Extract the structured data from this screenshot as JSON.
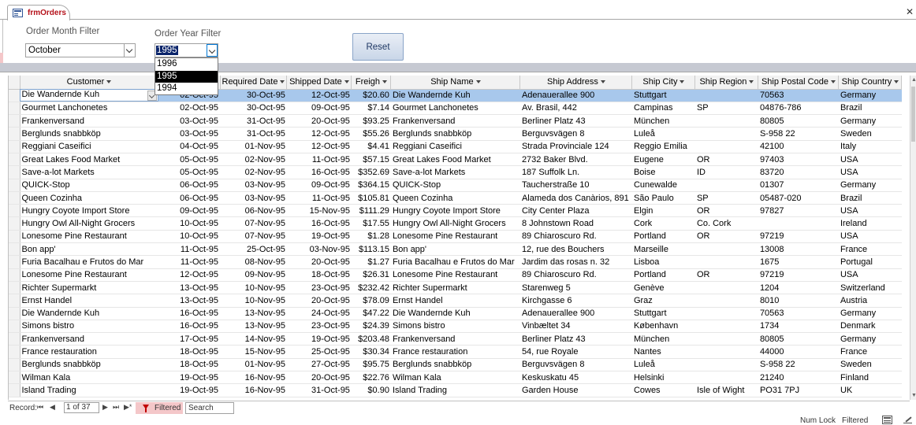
{
  "tab": {
    "title": "frmOrders",
    "close_glyph": "✕"
  },
  "filters": {
    "month_label": "Order Month Filter",
    "month_value": "October",
    "year_label": "Order Year Filter",
    "year_value": "1995",
    "year_options": [
      "1996",
      "1995",
      "1994"
    ],
    "year_selected_index": 1
  },
  "reset_label": "Reset",
  "table": {
    "columns": [
      "Customer",
      "Required Date",
      "Shipped Date",
      "Freigh",
      "Ship Name",
      "Ship Address",
      "Ship City",
      "Ship Region",
      "Ship Postal Code",
      "Ship Country"
    ],
    "current_row_index": 0,
    "rows": [
      [
        "Die Wandernde Kuh",
        "02-Oct-95",
        "30-Oct-95",
        "12-Oct-95",
        "$20.60",
        "Die Wandernde Kuh",
        "Adenauerallee 900",
        "Stuttgart",
        "",
        "70563",
        "Germany"
      ],
      [
        "Gourmet Lanchonetes",
        "02-Oct-95",
        "30-Oct-95",
        "09-Oct-95",
        "$7.14",
        "Gourmet Lanchonetes",
        "Av. Brasil, 442",
        "Campinas",
        "SP",
        "04876-786",
        "Brazil"
      ],
      [
        "Frankenversand",
        "03-Oct-95",
        "31-Oct-95",
        "20-Oct-95",
        "$93.25",
        "Frankenversand",
        "Berliner Platz 43",
        "München",
        "",
        "80805",
        "Germany"
      ],
      [
        "Berglunds snabbköp",
        "03-Oct-95",
        "31-Oct-95",
        "12-Oct-95",
        "$55.26",
        "Berglunds snabbköp",
        "Berguvsvägen  8",
        "Luleå",
        "",
        "S-958 22",
        "Sweden"
      ],
      [
        "Reggiani Caseifici",
        "04-Oct-95",
        "01-Nov-95",
        "12-Oct-95",
        "$4.41",
        "Reggiani Caseifici",
        "Strada Provinciale 124",
        "Reggio Emilia",
        "",
        "42100",
        "Italy"
      ],
      [
        "Great Lakes Food Market",
        "05-Oct-95",
        "02-Nov-95",
        "11-Oct-95",
        "$57.15",
        "Great Lakes Food Market",
        "2732 Baker Blvd.",
        "Eugene",
        "OR",
        "97403",
        "USA"
      ],
      [
        "Save-a-lot Markets",
        "05-Oct-95",
        "02-Nov-95",
        "16-Oct-95",
        "$352.69",
        "Save-a-lot Markets",
        "187 Suffolk Ln.",
        "Boise",
        "ID",
        "83720",
        "USA"
      ],
      [
        "QUICK-Stop",
        "06-Oct-95",
        "03-Nov-95",
        "09-Oct-95",
        "$364.15",
        "QUICK-Stop",
        "Taucherstraße 10",
        "Cunewalde",
        "",
        "01307",
        "Germany"
      ],
      [
        "Queen Cozinha",
        "06-Oct-95",
        "03-Nov-95",
        "11-Oct-95",
        "$105.81",
        "Queen Cozinha",
        "Alameda dos Canàrios, 891",
        "São Paulo",
        "SP",
        "05487-020",
        "Brazil"
      ],
      [
        "Hungry Coyote Import Store",
        "09-Oct-95",
        "06-Nov-95",
        "15-Nov-95",
        "$111.29",
        "Hungry Coyote Import Store",
        "City Center Plaza",
        "Elgin",
        "OR",
        "97827",
        "USA"
      ],
      [
        "Hungry Owl All-Night Grocers",
        "10-Oct-95",
        "07-Nov-95",
        "16-Oct-95",
        "$17.55",
        "Hungry Owl All-Night Grocers",
        "8 Johnstown Road",
        "Cork",
        "Co. Cork",
        "",
        "Ireland"
      ],
      [
        "Lonesome Pine Restaurant",
        "10-Oct-95",
        "07-Nov-95",
        "19-Oct-95",
        "$1.28",
        "Lonesome Pine Restaurant",
        "89 Chiaroscuro Rd.",
        "Portland",
        "OR",
        "97219",
        "USA"
      ],
      [
        "Bon app'",
        "11-Oct-95",
        "25-Oct-95",
        "03-Nov-95",
        "$113.15",
        "Bon app'",
        "12, rue des Bouchers",
        "Marseille",
        "",
        "13008",
        "France"
      ],
      [
        "Furia Bacalhau e Frutos do Mar",
        "11-Oct-95",
        "08-Nov-95",
        "20-Oct-95",
        "$1.27",
        "Furia Bacalhau e Frutos do Mar",
        "Jardim das rosas n. 32",
        "Lisboa",
        "",
        "1675",
        "Portugal"
      ],
      [
        "Lonesome Pine Restaurant",
        "12-Oct-95",
        "09-Nov-95",
        "18-Oct-95",
        "$26.31",
        "Lonesome Pine Restaurant",
        "89 Chiaroscuro Rd.",
        "Portland",
        "OR",
        "97219",
        "USA"
      ],
      [
        "Richter Supermarkt",
        "13-Oct-95",
        "10-Nov-95",
        "23-Oct-95",
        "$232.42",
        "Richter Supermarkt",
        "Starenweg 5",
        "Genève",
        "",
        "1204",
        "Switzerland"
      ],
      [
        "Ernst Handel",
        "13-Oct-95",
        "10-Nov-95",
        "20-Oct-95",
        "$78.09",
        "Ernst Handel",
        "Kirchgasse 6",
        "Graz",
        "",
        "8010",
        "Austria"
      ],
      [
        "Die Wandernde Kuh",
        "16-Oct-95",
        "13-Nov-95",
        "24-Oct-95",
        "$47.22",
        "Die Wandernde Kuh",
        "Adenauerallee 900",
        "Stuttgart",
        "",
        "70563",
        "Germany"
      ],
      [
        "Simons bistro",
        "16-Oct-95",
        "13-Nov-95",
        "23-Oct-95",
        "$24.39",
        "Simons bistro",
        "Vinbæltet 34",
        "København",
        "",
        "1734",
        "Denmark"
      ],
      [
        "Frankenversand",
        "17-Oct-95",
        "14-Nov-95",
        "19-Oct-95",
        "$203.48",
        "Frankenversand",
        "Berliner Platz 43",
        "München",
        "",
        "80805",
        "Germany"
      ],
      [
        "France restauration",
        "18-Oct-95",
        "15-Nov-95",
        "25-Oct-95",
        "$30.34",
        "France restauration",
        "54, rue Royale",
        "Nantes",
        "",
        "44000",
        "France"
      ],
      [
        "Berglunds snabbköp",
        "18-Oct-95",
        "01-Nov-95",
        "27-Oct-95",
        "$95.75",
        "Berglunds snabbköp",
        "Berguvsvägen  8",
        "Luleå",
        "",
        "S-958 22",
        "Sweden"
      ],
      [
        "Wilman Kala",
        "19-Oct-95",
        "16-Nov-95",
        "20-Oct-95",
        "$22.76",
        "Wilman Kala",
        "Keskuskatu 45",
        "Helsinki",
        "",
        "21240",
        "Finland"
      ],
      [
        "Island Trading",
        "19-Oct-95",
        "16-Nov-95",
        "31-Oct-95",
        "$0.90",
        "Island Trading",
        "Garden House",
        "Cowes",
        "Isle of Wight",
        "PO31 7PJ",
        "UK"
      ]
    ]
  },
  "navigator": {
    "record_label": "Record:",
    "position_text": "1 of 37",
    "first_glyph": "⏮",
    "prev_glyph": "◀",
    "next_glyph": "▶",
    "last_glyph": "⏭",
    "new_glyph": "▶*",
    "filtered_label": "Filtered",
    "search_placeholder": "Search"
  },
  "statusbar": {
    "numlock": "Num Lock",
    "filtered": "Filtered"
  },
  "colors": {
    "accent_tab": "#b5121b",
    "current_row": "#a8c8ec",
    "filtered_badge": "#f4c7c9"
  }
}
